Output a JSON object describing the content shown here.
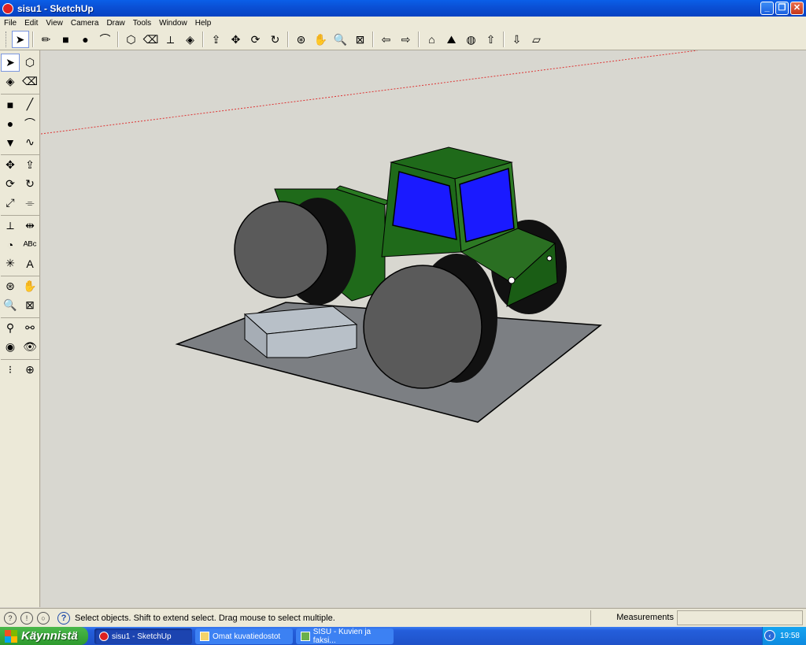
{
  "window": {
    "title": "sisu1 - SketchUp",
    "minimize": "_",
    "restore": "❐",
    "close": "✕"
  },
  "menu": [
    "File",
    "Edit",
    "View",
    "Camera",
    "Draw",
    "Tools",
    "Window",
    "Help"
  ],
  "toolbar": {
    "tools": [
      {
        "name": "select-tool",
        "glyph": "➤",
        "active": true
      },
      {
        "name": "pencil-tool",
        "glyph": "✏"
      },
      {
        "name": "rectangle-tool",
        "glyph": "■"
      },
      {
        "name": "circle-tool",
        "glyph": "●"
      },
      {
        "name": "arc-tool",
        "glyph": "⌒"
      },
      {
        "name": "make-component-tool",
        "glyph": "⬡"
      },
      {
        "name": "eraser-tool",
        "glyph": "⌫"
      },
      {
        "name": "tape-measure-tool",
        "glyph": "⟂"
      },
      {
        "name": "paint-bucket-tool",
        "glyph": "◈"
      },
      {
        "name": "push-pull-tool",
        "glyph": "⇪"
      },
      {
        "name": "move-tool",
        "glyph": "✥"
      },
      {
        "name": "rotate-tool",
        "glyph": "⟳"
      },
      {
        "name": "follow-me-tool",
        "glyph": "↻"
      },
      {
        "name": "orbit-tool",
        "glyph": "⊛"
      },
      {
        "name": "pan-tool",
        "glyph": "✋"
      },
      {
        "name": "zoom-tool",
        "glyph": "🔍"
      },
      {
        "name": "zoom-extents-tool",
        "glyph": "⊠"
      },
      {
        "name": "previous-view-tool",
        "glyph": "⇦"
      },
      {
        "name": "next-view-tool",
        "glyph": "⇨"
      },
      {
        "name": "add-location-tool",
        "glyph": "⌂"
      },
      {
        "name": "toggle-terrain-tool",
        "glyph": "⛰"
      },
      {
        "name": "get-models-tool",
        "glyph": "◍"
      },
      {
        "name": "share-model-tool",
        "glyph": "⇧"
      },
      {
        "name": "get-components-tool",
        "glyph": "⇩"
      },
      {
        "name": "send-to-layout-tool",
        "glyph": "▱"
      }
    ]
  },
  "left_tools": [
    {
      "name": "select-tool",
      "glyph": "➤",
      "active": true
    },
    {
      "name": "make-component-tool",
      "glyph": "⬡"
    },
    {
      "name": "paint-bucket-tool",
      "glyph": "◈"
    },
    {
      "name": "eraser-tool",
      "glyph": "⌫"
    },
    {
      "name": "rectangle-tool",
      "glyph": "■"
    },
    {
      "name": "line-tool",
      "glyph": "╱"
    },
    {
      "name": "circle-tool",
      "glyph": "●"
    },
    {
      "name": "arc-tool",
      "glyph": "⌒"
    },
    {
      "name": "polygon-tool",
      "glyph": "▼"
    },
    {
      "name": "freehand-tool",
      "glyph": "∿"
    },
    {
      "name": "move-tool",
      "glyph": "✥"
    },
    {
      "name": "push-pull-tool",
      "glyph": "⇪"
    },
    {
      "name": "rotate-tool",
      "glyph": "⟳"
    },
    {
      "name": "follow-me-tool",
      "glyph": "↻"
    },
    {
      "name": "scale-tool",
      "glyph": "⤢"
    },
    {
      "name": "offset-tool",
      "glyph": "⌯"
    },
    {
      "name": "tape-measure-tool",
      "glyph": "⟂"
    },
    {
      "name": "dimension-tool",
      "glyph": "⇹"
    },
    {
      "name": "protractor-tool",
      "glyph": "◔"
    },
    {
      "name": "text-tool",
      "glyph": "ᴬᴮᶜ"
    },
    {
      "name": "axes-tool",
      "glyph": "✳"
    },
    {
      "name": "3d-text-tool",
      "glyph": "A"
    },
    {
      "name": "orbit-tool",
      "glyph": "⊛"
    },
    {
      "name": "pan-tool",
      "glyph": "✋"
    },
    {
      "name": "zoom-tool",
      "glyph": "🔍"
    },
    {
      "name": "zoom-extents-tool",
      "glyph": "⊠"
    },
    {
      "name": "position-camera-tool",
      "glyph": "⚲"
    },
    {
      "name": "walk-tool",
      "glyph": "⚯"
    },
    {
      "name": "look-around-tool",
      "glyph": "◉"
    },
    {
      "name": "eye-tool",
      "glyph": "👁"
    },
    {
      "name": "footprints-tool",
      "glyph": "⁝"
    },
    {
      "name": "section-plane-tool",
      "glyph": "⊕"
    }
  ],
  "status": {
    "icons": [
      "geolocation-icon",
      "credits-icon",
      "user-icon"
    ],
    "help": "?",
    "text": "Select objects. Shift to extend select. Drag mouse to select multiple.",
    "measurements_label": "Measurements",
    "measurements_value": ""
  },
  "taskbar": {
    "start_label": "Käynnistä",
    "tasks": [
      {
        "label": "sisu1 - SketchUp",
        "active": true
      },
      {
        "label": "Omat kuvatiedostot",
        "active": false
      },
      {
        "label": "SISU - Kuvien ja faksi...",
        "active": false
      }
    ],
    "clock": "19:58"
  },
  "colors": {
    "cab": "#1f6a1a",
    "glass": "#1a1aff",
    "wheel": "#5a5a5a",
    "ground": "#7c7f83",
    "box": "#b8c0c8",
    "sky": "#d8d7d0"
  }
}
